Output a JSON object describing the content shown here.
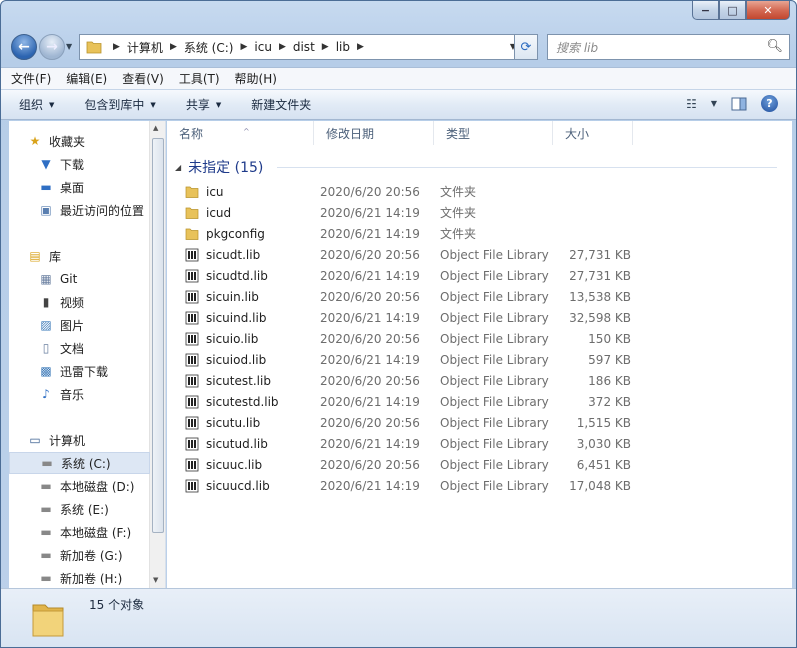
{
  "window": {
    "minimize": "−",
    "maximize": "□",
    "close": "✕"
  },
  "nav": {
    "back_glyph": "←",
    "forward_glyph": "→",
    "breadcrumbs": [
      "计算机",
      "系统 (C:)",
      "icu",
      "dist",
      "lib"
    ],
    "refresh_glyph": "⟳",
    "search_placeholder": "搜索 lib"
  },
  "menubar": [
    "文件(F)",
    "编辑(E)",
    "查看(V)",
    "工具(T)",
    "帮助(H)"
  ],
  "toolbar": {
    "organize": "组织",
    "include_in_library": "包含到库中",
    "share": "共享",
    "new_folder": "新建文件夹",
    "help_glyph": "?"
  },
  "sidebar": {
    "favorites": {
      "label": "收藏夹",
      "icon": "star-icon"
    },
    "favorite_items": [
      {
        "label": "下载",
        "icon": "download-folder-icon"
      },
      {
        "label": "桌面",
        "icon": "desktop-icon"
      },
      {
        "label": "最近访问的位置",
        "icon": "recent-places-icon"
      }
    ],
    "libraries": {
      "label": "库",
      "icon": "library-icon"
    },
    "library_items": [
      {
        "label": "Git",
        "icon": "git-icon"
      },
      {
        "label": "视频",
        "icon": "video-icon"
      },
      {
        "label": "图片",
        "icon": "picture-icon"
      },
      {
        "label": "文档",
        "icon": "document-icon"
      },
      {
        "label": "迅雷下载",
        "icon": "thunder-download-icon"
      },
      {
        "label": "音乐",
        "icon": "music-icon"
      }
    ],
    "computer": {
      "label": "计算机",
      "icon": "computer-icon"
    },
    "drives": [
      {
        "label": "系统 (C:)",
        "selected": true
      },
      {
        "label": "本地磁盘 (D:)",
        "selected": false
      },
      {
        "label": "系统 (E:)",
        "selected": false
      },
      {
        "label": "本地磁盘 (F:)",
        "selected": false
      },
      {
        "label": "新加卷 (G:)",
        "selected": false
      },
      {
        "label": "新加卷 (H:)",
        "selected": false
      }
    ]
  },
  "columns": {
    "name": "名称",
    "date": "修改日期",
    "type": "类型",
    "size": "大小"
  },
  "group": {
    "label": "未指定 (15)"
  },
  "files": [
    {
      "name": "icu",
      "date": "2020/6/20 20:56",
      "type": "文件夹",
      "size": "",
      "kind": "folder"
    },
    {
      "name": "icud",
      "date": "2020/6/21 14:19",
      "type": "文件夹",
      "size": "",
      "kind": "folder"
    },
    {
      "name": "pkgconfig",
      "date": "2020/6/21 14:19",
      "type": "文件夹",
      "size": "",
      "kind": "folder"
    },
    {
      "name": "sicudt.lib",
      "date": "2020/6/20 20:56",
      "type": "Object File Library",
      "size": "27,731 KB",
      "kind": "lib"
    },
    {
      "name": "sicudtd.lib",
      "date": "2020/6/21 14:19",
      "type": "Object File Library",
      "size": "27,731 KB",
      "kind": "lib"
    },
    {
      "name": "sicuin.lib",
      "date": "2020/6/20 20:56",
      "type": "Object File Library",
      "size": "13,538 KB",
      "kind": "lib"
    },
    {
      "name": "sicuind.lib",
      "date": "2020/6/21 14:19",
      "type": "Object File Library",
      "size": "32,598 KB",
      "kind": "lib"
    },
    {
      "name": "sicuio.lib",
      "date": "2020/6/20 20:56",
      "type": "Object File Library",
      "size": "150 KB",
      "kind": "lib"
    },
    {
      "name": "sicuiod.lib",
      "date": "2020/6/21 14:19",
      "type": "Object File Library",
      "size": "597 KB",
      "kind": "lib"
    },
    {
      "name": "sicutest.lib",
      "date": "2020/6/20 20:56",
      "type": "Object File Library",
      "size": "186 KB",
      "kind": "lib"
    },
    {
      "name": "sicutestd.lib",
      "date": "2020/6/21 14:19",
      "type": "Object File Library",
      "size": "372 KB",
      "kind": "lib"
    },
    {
      "name": "sicutu.lib",
      "date": "2020/6/20 20:56",
      "type": "Object File Library",
      "size": "1,515 KB",
      "kind": "lib"
    },
    {
      "name": "sicutud.lib",
      "date": "2020/6/21 14:19",
      "type": "Object File Library",
      "size": "3,030 KB",
      "kind": "lib"
    },
    {
      "name": "sicuuc.lib",
      "date": "2020/6/20 20:56",
      "type": "Object File Library",
      "size": "6,451 KB",
      "kind": "lib"
    },
    {
      "name": "sicuucd.lib",
      "date": "2020/6/21 14:19",
      "type": "Object File Library",
      "size": "17,048 KB",
      "kind": "lib"
    }
  ],
  "status": {
    "count": "15 个对象"
  },
  "colors": {
    "group_header": "#1e3a8a",
    "folder": "#e8c25a",
    "selection": "#dde7f4"
  }
}
